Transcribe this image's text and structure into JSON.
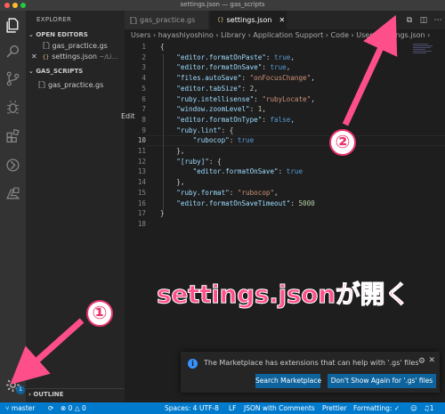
{
  "window": {
    "title": "settings.json — gas_scripts"
  },
  "sidebar": {
    "title": "EXPLORER",
    "open_editors_label": "OPEN EDITORS",
    "open_editors": [
      {
        "label": "gas_practice.gs",
        "detail": ""
      },
      {
        "label": "settings.json",
        "detail": "~/Li..."
      }
    ],
    "folder_label": "GAS_SCRIPTS",
    "files": [
      {
        "label": "gas_practice.gs"
      }
    ],
    "outline_label": "OUTLINE"
  },
  "tabs": [
    {
      "label": "gas_practice.gs",
      "active": false
    },
    {
      "label": "settings.json",
      "active": true,
      "icon": "{}"
    }
  ],
  "breadcrumb": "Users  ›  hayashiyoshino  ›  Library  ›  Application Support  ›  Code  ›  User  ›  settings.json  ›",
  "editor": {
    "current_line": 10,
    "hover_hint": "Edit",
    "lines": [
      {
        "n": "1",
        "text": "{"
      },
      {
        "n": "2",
        "text": "    \"editor.formatOnPaste\": true,"
      },
      {
        "n": "3",
        "text": "    \"editor.formatOnSave\": true,"
      },
      {
        "n": "4",
        "text": "    \"files.autoSave\": \"onFocusChange\","
      },
      {
        "n": "5",
        "text": "    \"editor.tabSize\": 2,"
      },
      {
        "n": "6",
        "text": "    \"ruby.intellisense\": \"rubyLocate\","
      },
      {
        "n": "7",
        "text": "    \"window.zoomLevel\": 1,"
      },
      {
        "n": "8",
        "text": "    \"editor.formatOnType\": false,"
      },
      {
        "n": "9",
        "text": "    \"ruby.lint\": {"
      },
      {
        "n": "10",
        "text": "        \"rubocop\": true"
      },
      {
        "n": "11",
        "text": "    },"
      },
      {
        "n": "12",
        "text": "    \"[ruby]\": {"
      },
      {
        "n": "13",
        "text": "        \"editor.formatOnSave\": true"
      },
      {
        "n": "14",
        "text": "    },"
      },
      {
        "n": "15",
        "text": "    \"ruby.format\": \"rubocop\","
      },
      {
        "n": "16",
        "text": "    \"editor.formatOnSaveTimeout\": 5000"
      },
      {
        "n": "17",
        "text": "}"
      },
      {
        "n": "18",
        "text": ""
      }
    ]
  },
  "notification": {
    "message": "The Marketplace has extensions that can help with '.gs' files",
    "primary_button": "Search Marketplace",
    "secondary_button": "Don't Show Again for '.gs' files"
  },
  "activity_badge": "1",
  "statusbar": {
    "branch": "master",
    "errors": "0",
    "warnings": "0",
    "spaces": "Spaces: 4",
    "encoding": "UTF-8",
    "eol": "LF",
    "language": "JSON with Comments",
    "formatter": "Prettier",
    "formatting": "Formatting: ✓",
    "notifications": "1"
  },
  "annotations": {
    "marker1": "①",
    "marker2": "②",
    "caption": "settings.jsonが開く"
  },
  "colors": {
    "annotation": "#ff4f8b",
    "statusbar": "#007acc",
    "button": "#0e639c"
  }
}
